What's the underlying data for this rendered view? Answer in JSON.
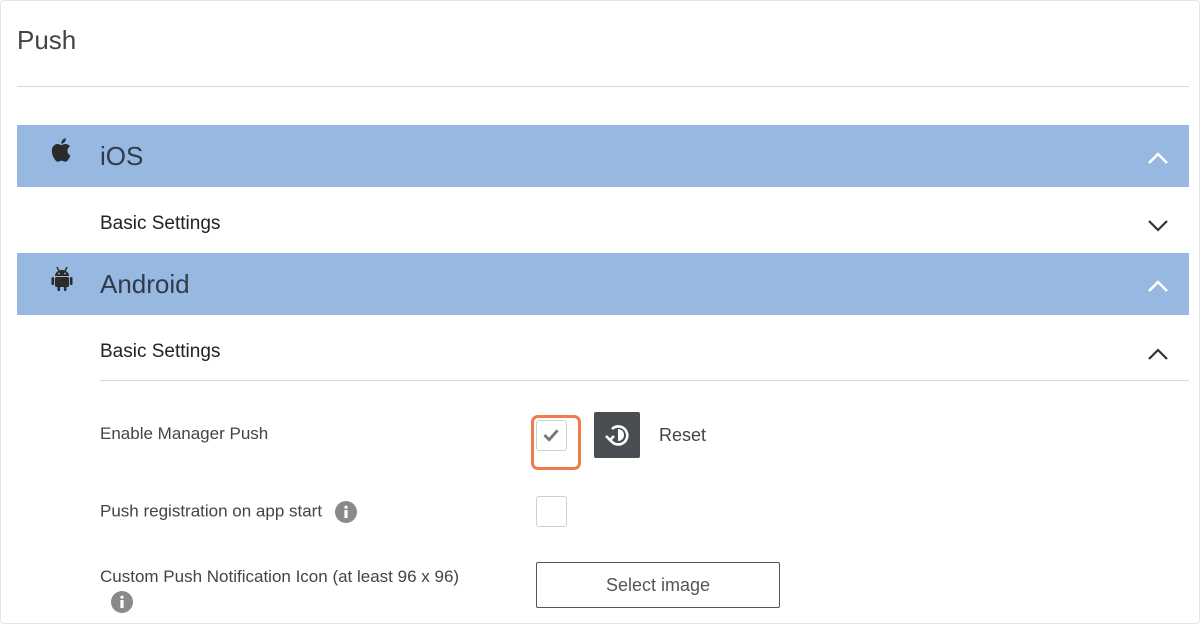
{
  "page": {
    "title": "Push"
  },
  "platforms": [
    {
      "name": "iOS",
      "icon": "apple-icon",
      "expanded": true,
      "sections": [
        {
          "label": "Basic Settings",
          "expanded": false
        }
      ]
    },
    {
      "name": "Android",
      "icon": "android-icon",
      "expanded": true,
      "sections": [
        {
          "label": "Basic Settings",
          "expanded": true
        }
      ]
    }
  ],
  "settings": {
    "enable_manager_push": {
      "label": "Enable Manager Push",
      "checked": true,
      "reset_label": "Reset"
    },
    "push_registration": {
      "label": "Push registration on app start",
      "checked": false
    },
    "custom_icon": {
      "label": "Custom Push Notification Icon (at least 96 x 96)",
      "button_label": "Select image"
    }
  },
  "colors": {
    "platform_bar": "#97b8e0",
    "focus_ring": "#f07b4b",
    "reset_button": "#4a4d52"
  }
}
